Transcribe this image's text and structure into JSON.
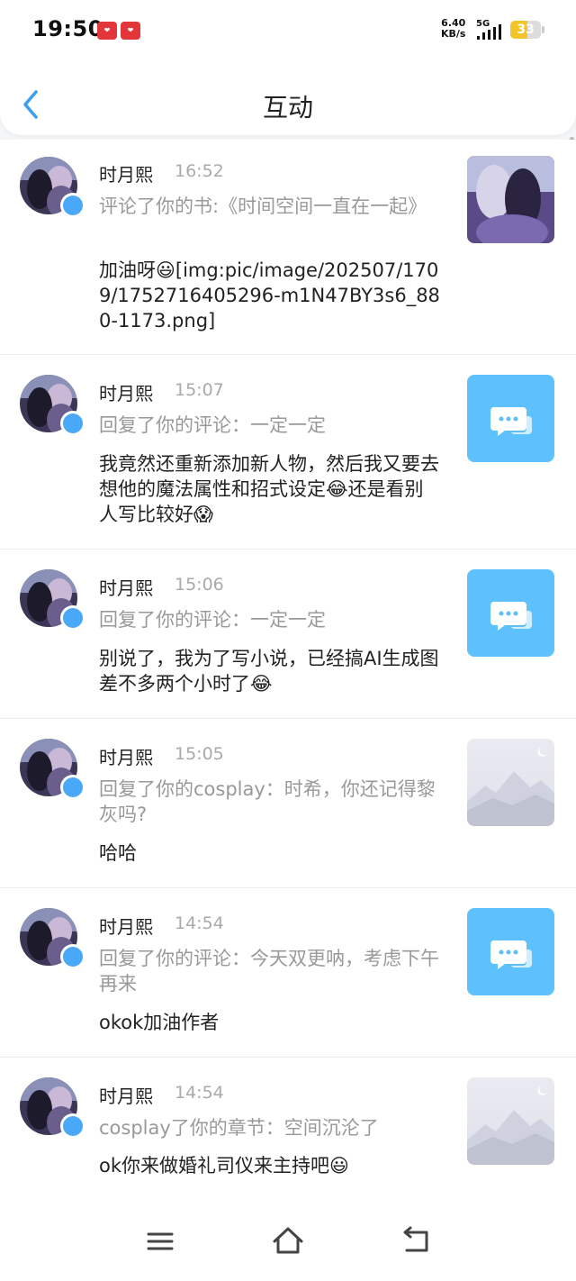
{
  "status_bar": {
    "time": "19:50",
    "net_speed_value": "6.40",
    "net_speed_unit": "KB/s",
    "network": "5G",
    "battery": "33"
  },
  "header": {
    "title": "互动",
    "back_icon": "chevron-left-icon"
  },
  "items": [
    {
      "name": "时月熙",
      "time": "16:52",
      "ref": "评论了你的书:《时间空间一直在一起》",
      "message": "加油呀😃[img:pic/image/202507/1709/1752716405296-m1N47BY3s6_880-1173.png]",
      "thumb": "cover-image"
    },
    {
      "name": "时月熙",
      "time": "15:07",
      "ref": "回复了你的评论：一定一定",
      "message": "我竟然还重新添加新人物，然后我又要去想他的魔法属性和招式设定😂还是看别人写比较好😱",
      "thumb": "chat-bubble-icon"
    },
    {
      "name": "时月熙",
      "time": "15:06",
      "ref": "回复了你的评论：一定一定",
      "message": "别说了，我为了写小说，已经搞AI生成图差不多两个小时了😂",
      "thumb": "chat-bubble-icon"
    },
    {
      "name": "时月熙",
      "time": "15:05",
      "ref": "回复了你的cosplay：时希，你还记得黎灰吗?",
      "message": "哈哈",
      "thumb": "image-placeholder-icon"
    },
    {
      "name": "时月熙",
      "time": "14:54",
      "ref": "回复了你的评论：今天双更呐，考虑下午再来",
      "message": "okok加油作者",
      "thumb": "chat-bubble-icon"
    },
    {
      "name": "时月熙",
      "time": "14:54",
      "ref": "cosplay了你的章节：空间沉沦了",
      "message": "ok你来做婚礼司仪来主持吧😃",
      "thumb": "image-placeholder-icon"
    }
  ],
  "nav_bar": {
    "menu_icon": "menu-icon",
    "home_icon": "home-icon",
    "back_icon": "back-icon"
  },
  "colors": {
    "accent": "#4aa8f8",
    "chat_thumb": "#5ec0fc",
    "muted_text": "#999999",
    "battery": "#f4c52b"
  }
}
